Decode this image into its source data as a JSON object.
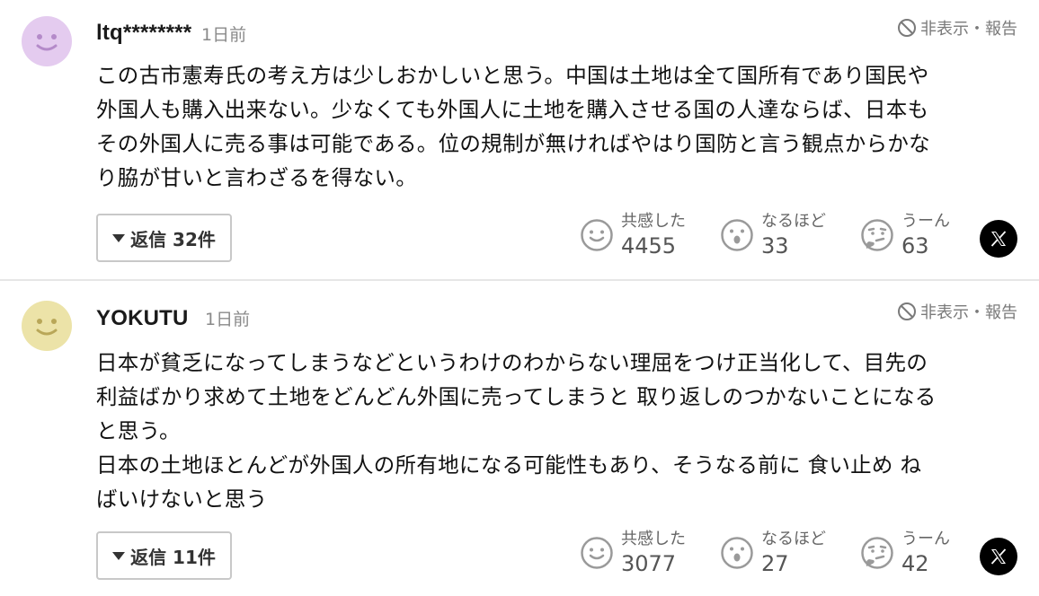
{
  "colors": {
    "avatar1": "#e4cbef",
    "avatar1_face": "#b48ac9",
    "avatar2": "#ece3a8",
    "avatar2_face": "#b9a758",
    "icon_gray": "#9a9a9a"
  },
  "comments": [
    {
      "username": "ltq********",
      "time": "1日前",
      "hide_report": "非表示・報告",
      "body": "この古市憲寿氏の考え方は少しおかしいと思う。中国は土地は全て国所有であり国民や\n外国人も購入出来ない。少なくても外国人に土地を購入させる国の人達ならば、日本も\nその外国人に売る事は可能である。位の規制が無ければやはり国防と言う観点からかな\nり脇が甘いと言わざるを得ない。",
      "reply_label": "返信 32件",
      "reactions": [
        {
          "icon": "smile-face-icon",
          "label": "共感した",
          "count": "4455"
        },
        {
          "icon": "surprised-face-icon",
          "label": "なるほど",
          "count": "33"
        },
        {
          "icon": "thinking-face-icon",
          "label": "うーん",
          "count": "63"
        }
      ],
      "share_icon": "x-logo-icon"
    },
    {
      "username": "YOKUTU",
      "time": "1日前",
      "hide_report": "非表示・報告",
      "body": "日本が貧乏になってしまうなどというわけのわからない理屈をつけ正当化して、目先の\n利益ばかり求めて土地をどんどん外国に売ってしまうと 取り返しのつかないことになる\nと思う。\n日本の土地ほとんどが外国人の所有地になる可能性もあり、そうなる前に 食い止め ね\nばいけないと思う",
      "reply_label": "返信 11件",
      "reactions": [
        {
          "icon": "smile-face-icon",
          "label": "共感した",
          "count": "3077"
        },
        {
          "icon": "surprised-face-icon",
          "label": "なるほど",
          "count": "27"
        },
        {
          "icon": "thinking-face-icon",
          "label": "うーん",
          "count": "42"
        }
      ],
      "share_icon": "x-logo-icon"
    }
  ]
}
